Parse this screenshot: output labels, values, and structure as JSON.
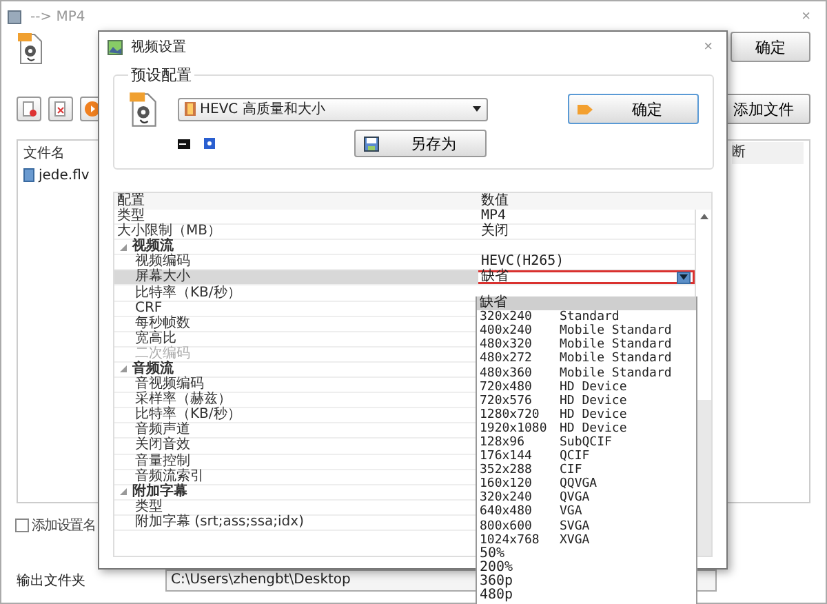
{
  "main_window": {
    "title": "--> MP4",
    "close": "×",
    "ok_button": "确定",
    "add_file_button": "添加文件",
    "file_list": {
      "columns": [
        "文件名",
        "断"
      ],
      "rows": [
        {
          "name": "jede.flv"
        }
      ]
    },
    "add_preset_name": {
      "label": "添加设置名",
      "checked": false
    },
    "output_folder": {
      "label": "输出文件夹",
      "value": "C:\\Users\\zhengbt\\Desktop"
    }
  },
  "dialog": {
    "title": "视频设置",
    "close": "×",
    "preset_group": "预设配置",
    "preset_select": "HEVC 高质量和大小",
    "ok_button": "确定",
    "save_as_button": "另存为",
    "grid": {
      "columns": [
        "配置",
        "数值"
      ],
      "rows": [
        {
          "kind": "property",
          "name": "类型",
          "value": "MP4",
          "selected": false,
          "disabled": false
        },
        {
          "kind": "property",
          "name": "大小限制（MB）",
          "value": "关闭",
          "selected": false,
          "disabled": false
        },
        {
          "kind": "category",
          "name": "视频流",
          "expanded": true,
          "selected": false,
          "children": [
            {
              "kind": "property",
              "name": "视频编码",
              "value": "HEVC(H265)",
              "selected": false,
              "disabled": false
            },
            {
              "kind": "property",
              "name": "屏幕大小",
              "value": "缺省",
              "selected": true,
              "disabled": false
            },
            {
              "kind": "property",
              "name": "比特率（KB/秒）",
              "selected": false,
              "disabled": false
            },
            {
              "kind": "property",
              "name": "CRF",
              "selected": false,
              "disabled": false
            },
            {
              "kind": "property",
              "name": "每秒帧数",
              "selected": false,
              "disabled": false
            },
            {
              "kind": "property",
              "name": "宽高比",
              "selected": false,
              "disabled": false
            },
            {
              "kind": "property",
              "name": "二次编码",
              "selected": false,
              "disabled": true
            }
          ]
        },
        {
          "kind": "category",
          "name": "音频流",
          "expanded": true,
          "selected": false,
          "children": [
            {
              "kind": "property",
              "name": "音视频编码",
              "selected": false,
              "disabled": false
            },
            {
              "kind": "property",
              "name": "采样率（赫兹）",
              "selected": false,
              "disabled": false
            },
            {
              "kind": "property",
              "name": "比特率（KB/秒）",
              "selected": false,
              "disabled": false
            },
            {
              "kind": "property",
              "name": "音频声道",
              "selected": false,
              "disabled": false
            },
            {
              "kind": "property",
              "name": "关闭音效",
              "selected": false,
              "disabled": false
            },
            {
              "kind": "property",
              "name": "音量控制",
              "selected": false,
              "disabled": false
            },
            {
              "kind": "property",
              "name": "音频流索引",
              "selected": false,
              "disabled": false
            }
          ]
        },
        {
          "kind": "category",
          "name": "附加字幕",
          "expanded": true,
          "selected": false,
          "children": [
            {
              "kind": "property",
              "name": "类型",
              "selected": false,
              "disabled": false
            },
            {
              "kind": "property",
              "name": "附加字幕 (srt;ass;ssa;idx)",
              "selected": false,
              "disabled": false
            }
          ]
        }
      ]
    }
  },
  "dropdown_list": [
    {
      "size": "缺省",
      "selected": true
    },
    {
      "size": "320x240",
      "label": "Standard",
      "selected": false
    },
    {
      "size": "400x240",
      "label": "Mobile Standard",
      "selected": false
    },
    {
      "size": "480x320",
      "label": "Mobile Standard",
      "selected": false
    },
    {
      "size": "480x272",
      "label": "Mobile Standard",
      "selected": false
    },
    {
      "size": "480x360",
      "label": "Mobile Standard",
      "selected": false
    },
    {
      "size": "720x480",
      "label": "HD Device",
      "selected": false
    },
    {
      "size": "720x576",
      "label": "HD Device",
      "selected": false
    },
    {
      "size": "1280x720",
      "label": "HD Device",
      "selected": false
    },
    {
      "size": "1920x1080",
      "label": "HD Device",
      "selected": false
    },
    {
      "size": "128x96",
      "label": "SubQCIF",
      "selected": false
    },
    {
      "size": "176x144",
      "label": "QCIF",
      "selected": false
    },
    {
      "size": "352x288",
      "label": "CIF",
      "selected": false
    },
    {
      "size": "160x120",
      "label": "QQVGA",
      "selected": false
    },
    {
      "size": "320x240",
      "label": "QVGA",
      "selected": false
    },
    {
      "size": "640x480",
      "label": "VGA",
      "selected": false
    },
    {
      "size": "800x600",
      "label": "SVGA",
      "selected": false
    },
    {
      "size": "1024x768",
      "label": "XVGA",
      "selected": false
    },
    {
      "size": "50%",
      "selected": false
    },
    {
      "size": "200%",
      "selected": false
    },
    {
      "size": "360p",
      "selected": false
    },
    {
      "size": "480p",
      "selected": false
    }
  ]
}
